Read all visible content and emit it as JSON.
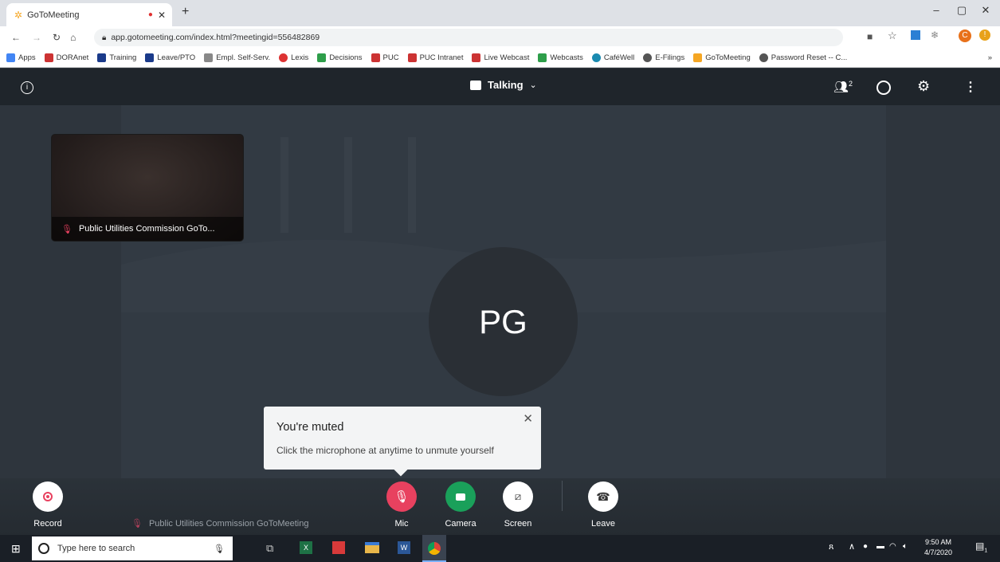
{
  "browser": {
    "tab_title": "GoToMeeting",
    "url": "app.gotomeeting.com/index.html?meetingid=556482869",
    "bookmarks": [
      "Apps",
      "DORAnet",
      "Training",
      "Leave/PTO",
      "Empl. Self-Serv.",
      "Lexis",
      "Decisions",
      "PUC",
      "PUC Intranet",
      "Live Webcast",
      "Webcasts",
      "CaféWell",
      "E-Filings",
      "GoToMeeting",
      "Password Reset -- C..."
    ],
    "profile_initial": "C"
  },
  "meeting": {
    "title": "Talking",
    "participant_count": "2",
    "self_video_label": "Public Utilities Commission GoTo...",
    "active_speaker_initials": "PG",
    "bottom_attendee_label": "Public Utilities Commission GoToMeeting"
  },
  "toast": {
    "title": "You're muted",
    "message": "Click the microphone at anytime to unmute yourself"
  },
  "controls": {
    "record": "Record",
    "mic": "Mic",
    "camera": "Camera",
    "screen": "Screen",
    "leave": "Leave"
  },
  "colors": {
    "mic_muted": "#e8415f",
    "camera_on": "#1aa05a",
    "record_dot": "#e8415f"
  },
  "taskbar": {
    "search_placeholder": "Type here to search",
    "time": "9:50 AM",
    "date": "4/7/2020",
    "notification_count": "1"
  }
}
